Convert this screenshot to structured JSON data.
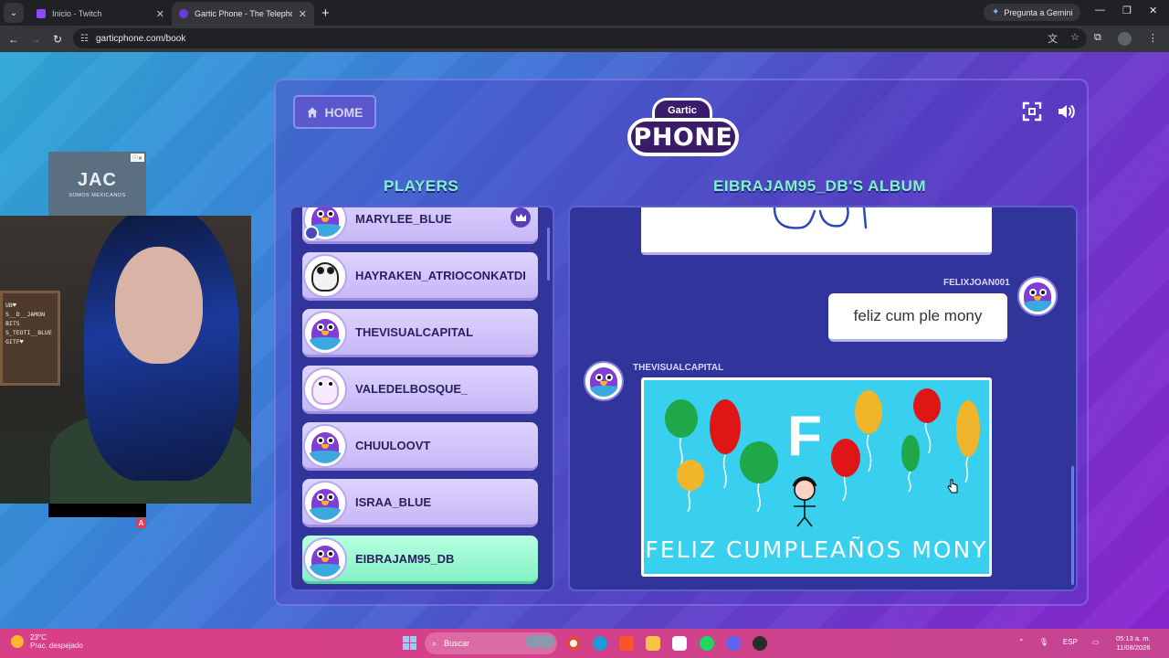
{
  "browser": {
    "tabs": [
      {
        "title": "Inicio - Twitch",
        "active": false
      },
      {
        "title": "Gartic Phone - The Telephone Game",
        "active": true
      }
    ],
    "gemini_label": "Pregunta a Gemini",
    "url": "garticphone.com/book"
  },
  "stream": {
    "ad_logo": "JAC",
    "ad_text": "SOMOS MEXICANOS",
    "board_lines": [
      "UB♥",
      "S__D__JAMON",
      "BITS",
      "S_TEOTI__BLUE",
      "GITF♥"
    ],
    "badge": "A"
  },
  "game": {
    "home_label": "HOME",
    "logo_top": "Gartic",
    "logo_main": "PHONE",
    "players_title": "PLAYERS",
    "album_title": "EIBRAJAM95_DB'S ALBUM",
    "players": [
      {
        "name": "MARYLEE_BLUE",
        "avatar": "bird",
        "crown": true
      },
      {
        "name": "HAYRAKEN_ATRIOCONKATDI",
        "avatar": "panda"
      },
      {
        "name": "THEVISUALCAPITAL",
        "avatar": "bird"
      },
      {
        "name": "VALEDELBOSQUE_",
        "avatar": "unicorn"
      },
      {
        "name": "CHUULOOVT",
        "avatar": "bird"
      },
      {
        "name": "ISRAA_BLUE",
        "avatar": "bird"
      },
      {
        "name": "EIBRAJAM95_DB",
        "avatar": "bird",
        "highlighted": true
      }
    ],
    "album": {
      "message_author": "FELIXJOAN001",
      "message_text": "feliz cum ple mony",
      "drawing_author": "THEVISUALCAPITAL",
      "drawing_text": "FELIZ CUMPLEAÑOS MONY",
      "drawing_letter": "F"
    }
  },
  "taskbar": {
    "weather_temp": "23°C",
    "weather_desc": "Prac. despejado",
    "search_label": "Buscar",
    "language": "ESP",
    "time": "05:13 a. m.",
    "date": "11/08/2026"
  },
  "colors": {
    "accent_green": "#7ef6c8",
    "panel": "#30349b",
    "drawing_bg": "#39d0f0",
    "taskbar": "#d83f86"
  }
}
